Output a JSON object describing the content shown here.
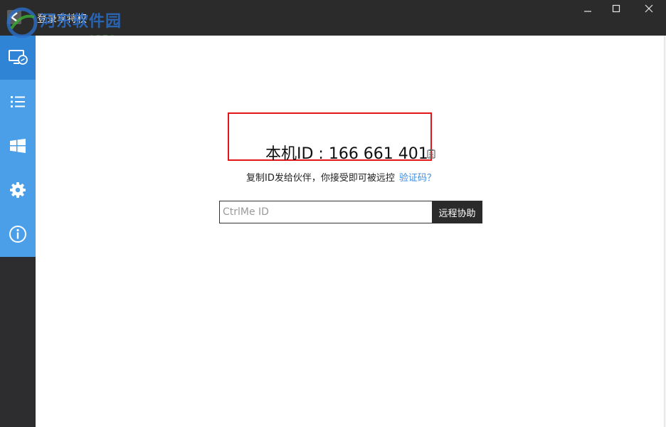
{
  "window": {
    "title": "登录享特权"
  },
  "watermark": {
    "title": "河东软件园",
    "url": "www.pc0359.cn"
  },
  "sidebar": {
    "items": [
      {
        "icon": "remote-desktop-icon",
        "active": true
      },
      {
        "icon": "list-icon",
        "active": false
      },
      {
        "icon": "windows-icon",
        "active": false
      },
      {
        "icon": "gear-icon",
        "active": false
      },
      {
        "icon": "info-icon",
        "active": false
      }
    ]
  },
  "main": {
    "machine_id_label": "本机ID : 166 661 401",
    "hint_text": "复制ID发给伙伴，你接受即可被远控",
    "verify_link": "验证码？",
    "input": {
      "value": "",
      "placeholder": "CtrlMe ID"
    },
    "remote_button": "远程协助"
  },
  "colors": {
    "titlebar": "#2b2b2b",
    "sidebar_blue": "#4a9fe8",
    "sidebar_active": "#2f84d6",
    "sidebar_dark": "#2d2d30",
    "highlight_border": "#e0161b",
    "link": "#3a8ee6"
  }
}
